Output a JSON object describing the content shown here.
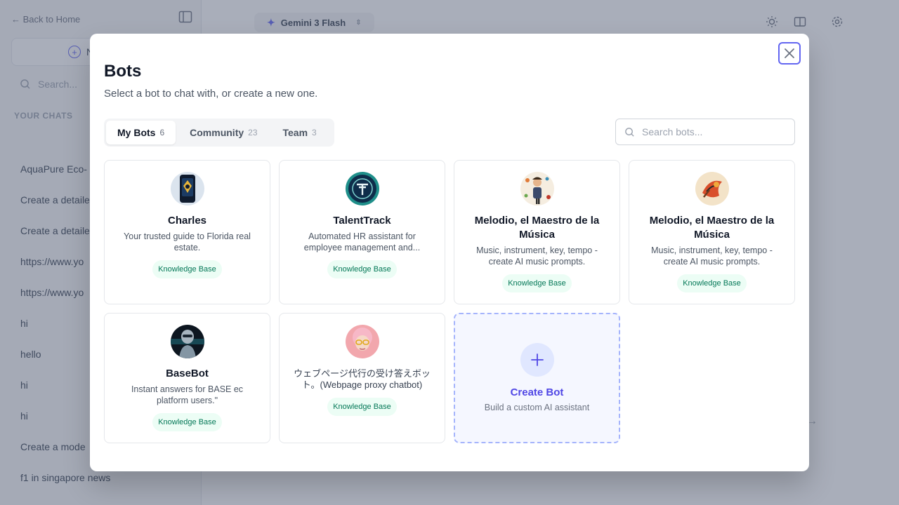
{
  "background": {
    "back_link": "← Back to Home",
    "new_chat_label": "N",
    "search_placeholder": "Search...",
    "section_title": "YOUR CHATS",
    "chats": [
      "AquaPure Eco-",
      "Create a detaile",
      "Create a detaile",
      "https://www.yo",
      "https://www.yo",
      "hi",
      "hello",
      "hi",
      "hi",
      "Create a mode",
      "f1 in singapore news"
    ],
    "model_name": "Gemini 3 Flash"
  },
  "modal": {
    "title": "Bots",
    "subtitle": "Select a bot to chat with, or create a new one.",
    "tabs": [
      {
        "label": "My Bots",
        "count": "6"
      },
      {
        "label": "Community",
        "count": "23"
      },
      {
        "label": "Team",
        "count": "3"
      }
    ],
    "search_placeholder": "Search bots...",
    "bots": [
      {
        "name": "Charles",
        "description": "Your trusted guide to Florida real estate.",
        "badge": "Knowledge Base"
      },
      {
        "name": "TalentTrack",
        "description": "Automated HR assistant for employee management and...",
        "badge": "Knowledge Base"
      },
      {
        "name": "Melodio, el Maestro de la Música",
        "description": "Music, instrument, key, tempo - create AI music prompts.",
        "badge": "Knowledge Base"
      },
      {
        "name": "Melodio, el Maestro de la Música",
        "description": "Music, instrument, key, tempo - create AI music prompts.",
        "badge": "Knowledge Base"
      },
      {
        "name": "BaseBot",
        "description": "Instant answers for BASE ec platform users.\"",
        "badge": "Knowledge Base"
      },
      {
        "name": "",
        "description": "ウェブページ代行の受け答えボット。(Webpage proxy chatbot)",
        "badge": "Knowledge Base"
      }
    ],
    "create": {
      "title": "Create Bot",
      "subtitle": "Build a custom AI assistant"
    }
  },
  "colors": {
    "accent": "#6366f1",
    "badge_bg": "#ecfdf5",
    "badge_text": "#047857"
  }
}
